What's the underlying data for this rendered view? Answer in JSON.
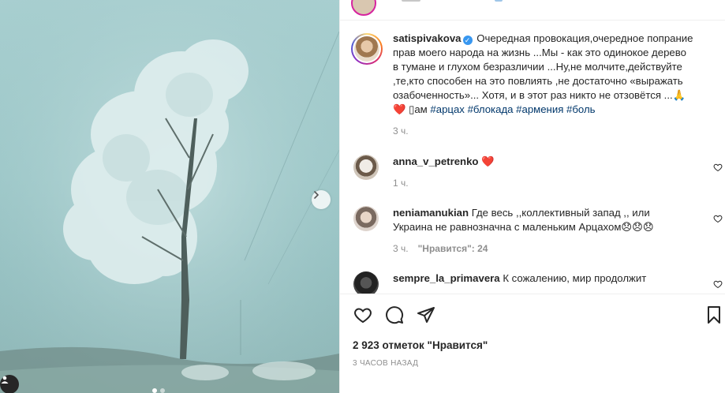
{
  "post": {
    "image_alt": "",
    "carousel_dots": 2
  },
  "header": {
    "username_hidden": ""
  },
  "caption": {
    "username": "satispivakova",
    "text_line1": "Очередная провокация,очередное попрание",
    "text_line2": "прав моего народа на жизнь ...Мы - как это одинокое дерево",
    "text_line3": "в тумане и глухом безразличии ...Ну,не молчите,действуйте",
    "text_line4": ",те,кто способен на это повлиять ,не достаточно «выражать",
    "text_line5": "озабоченность»... Хотя, и в этот раз никто не отзовётся ...🙏",
    "text_line6_prefix": "❤️ ▯ам",
    "hashtags": [
      "#арцах",
      "#блокада",
      "#армения",
      "#боль"
    ],
    "time": "3 ч."
  },
  "comments": [
    {
      "username": "anna_v_petrenko",
      "text": "❤️",
      "time": "1 ч.",
      "likes": ""
    },
    {
      "username": "neniamanukian",
      "text": "Где весь ,,коллективный запад ,, или",
      "text2": "Украина не равнозначна с маленьким Арцахом😞😞😞",
      "time": "3 ч.",
      "likes": "\"Нравится\": 24"
    },
    {
      "username": "sempre_la_primavera",
      "text": "К сожалению, мир продолжит",
      "time": "",
      "likes": ""
    }
  ],
  "actions": {
    "likes_count": "2 923 отметок \"Нравится\"",
    "posted": "3 часов назад"
  },
  "icons": {
    "like": "heart-icon",
    "comment": "comment-icon",
    "share": "paper-plane-icon",
    "save": "bookmark-icon",
    "next": "chevron-right-icon",
    "tags": "user-tag-icon"
  },
  "colors": {
    "hashtag": "#00376b",
    "verified": "#3897f0",
    "muted": "#8e8e8e",
    "heart": "#ed4956"
  }
}
